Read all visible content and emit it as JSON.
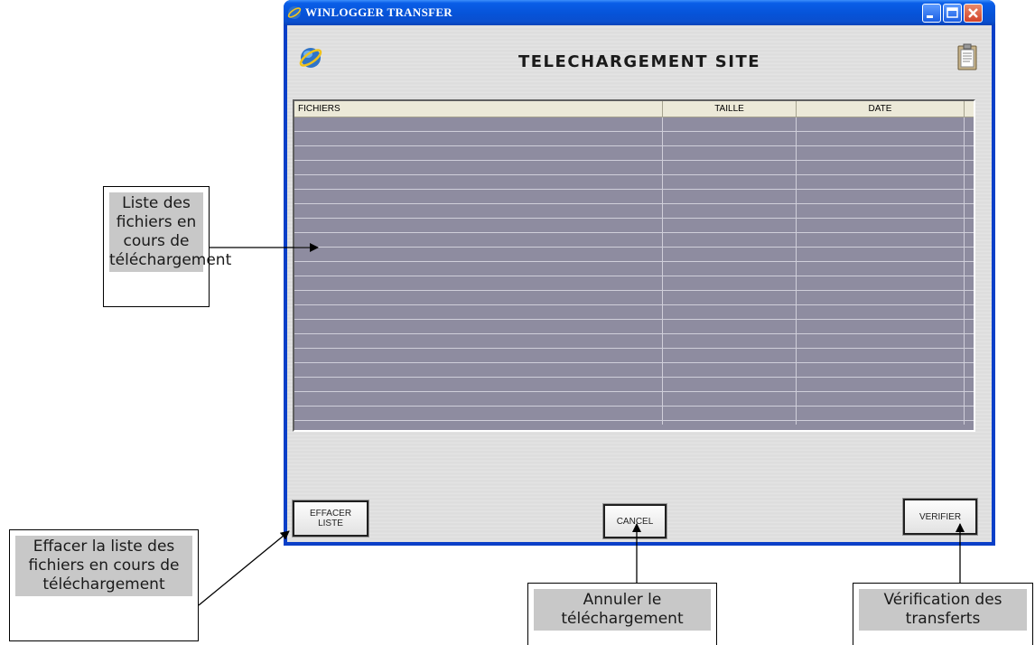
{
  "window": {
    "title": "WINLOGGER TRANSFER",
    "heading": "TELECHARGEMENT SITE"
  },
  "table": {
    "columns": [
      "FICHIERS",
      "TAILLE",
      "DATE"
    ],
    "rows": []
  },
  "buttons": {
    "effacer": "EFFACER\nLISTE",
    "cancel": "CANCEL",
    "verifier": "VERIFIER"
  },
  "callouts": {
    "list": "Liste des fichiers en cours de téléchargement",
    "effacer": "Effacer la liste des fichiers en cours de téléchargement",
    "annuler": "Annuler le téléchargement",
    "verification": "Vérification des transferts"
  },
  "colors": {
    "titlebar": "#0a5ee8",
    "grid_rows": "#8e8ca0",
    "close_button": "#d2432a"
  }
}
